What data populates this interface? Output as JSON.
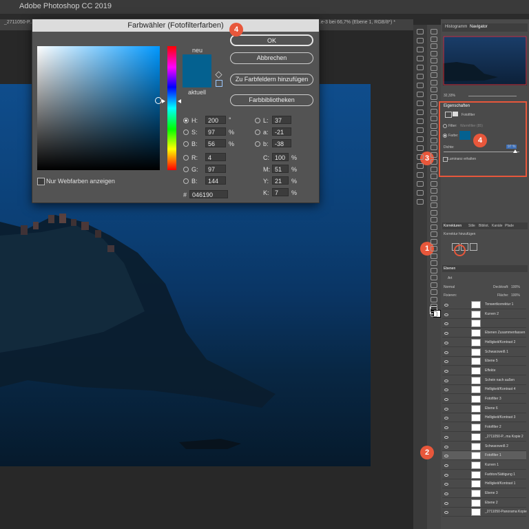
{
  "app": {
    "title": "Adobe Photoshop CC 2019"
  },
  "document": {
    "tab_left": "_2711050-P...",
    "tab_right": "...e-3 bei 66,7% (Ebene 1, RGB/8*) *"
  },
  "dialog": {
    "title": "Farbwähler (Fotofilterfarben)",
    "new_label": "neu",
    "current_label": "aktuell",
    "web_colors_label": "Nur Webfarben anzeigen",
    "buttons": {
      "ok": "OK",
      "cancel": "Abbrechen",
      "add_swatch": "Zu Farbfeldern hinzufügen",
      "libraries": "Farbbibliotheken"
    },
    "fields": {
      "H": {
        "label": "H:",
        "value": "200",
        "unit": "°"
      },
      "S": {
        "label": "S:",
        "value": "97",
        "unit": "%"
      },
      "Bv": {
        "label": "B:",
        "value": "56",
        "unit": "%"
      },
      "R": {
        "label": "R:",
        "value": "4"
      },
      "G": {
        "label": "G:",
        "value": "97"
      },
      "B": {
        "label": "B:",
        "value": "144"
      },
      "L": {
        "label": "L:",
        "value": "37"
      },
      "a": {
        "label": "a:",
        "value": "-21"
      },
      "b": {
        "label": "b:",
        "value": "-38"
      },
      "C": {
        "label": "C:",
        "value": "100",
        "unit": "%"
      },
      "M": {
        "label": "M:",
        "value": "51",
        "unit": "%"
      },
      "Y": {
        "label": "Y:",
        "value": "21",
        "unit": "%"
      },
      "K": {
        "label": "K:",
        "value": "7",
        "unit": "%"
      },
      "hex": {
        "label": "#",
        "value": "046190"
      }
    },
    "color_hex": "#046190"
  },
  "badges": {
    "dialog": "4",
    "properties": "4",
    "toolbar": "3",
    "adjustments": "1",
    "layers": "2"
  },
  "navigator": {
    "tabs": [
      "Histogramm",
      "Navigator"
    ],
    "zoom": "32,33%"
  },
  "properties": {
    "tab": "Eigenschaften",
    "type": "Fotofilter",
    "filter_label": "Filter:",
    "filter_value": "Warmfilter (85)",
    "color_label": "Farbe:",
    "density_label": "Dichte:",
    "density_value": "97 %",
    "luminance_label": "Luminanz erhalten"
  },
  "adjustments": {
    "tabs": [
      "Korrekturen",
      "Stile",
      "Bibliot.",
      "Kanäle",
      "Pfade"
    ],
    "hint": "Korrektur hinzufügen"
  },
  "layers_panel": {
    "tab": "Ebenen",
    "kind": "Art",
    "blend": "Normal",
    "opacity_label": "Deckkraft:",
    "opacity": "100%",
    "lock_label": "Fixieren:",
    "fill_label": "Fläche:",
    "fill": "100%",
    "layers": [
      "Tonwertkorrektur 1",
      "Kurven 2",
      "",
      "Ebenen Zusammenfassen",
      "Helligkeit/Kontrast 2",
      "Schwarzweiß 1",
      "Ebene 5",
      "Effekte",
      "Schein nach außen",
      "Helligkeit/Kontrast 4",
      "Fotofilter 3",
      "Ebene 6",
      "Helligkeit/Kontrast 3",
      "Fotofilter 2",
      "_2711050-P...ma Kopie 2",
      "Schwarzweiß 2",
      "Fotofilter 1",
      "Kurven 1",
      "Farbton/Sättigung 1",
      "Helligkeit/Kontrast 1",
      "Ebene 3",
      "Ebene 2",
      "_2711050-Panorama Kopie"
    ]
  }
}
